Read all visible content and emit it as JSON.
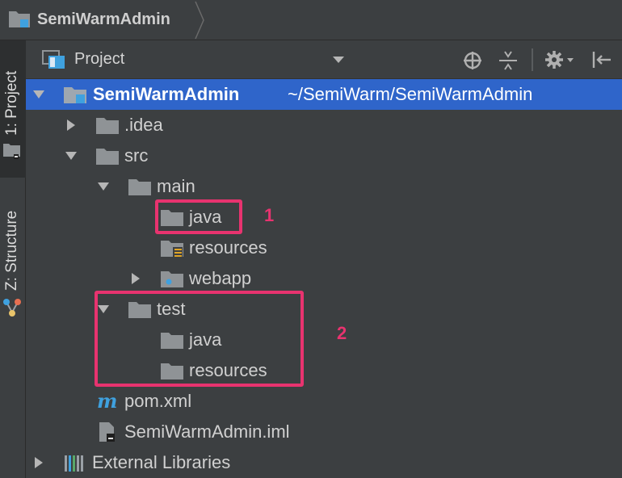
{
  "breadcrumb": {
    "project": "SemiWarmAdmin"
  },
  "side_tabs": {
    "project": "1: Project",
    "structure": "Z: Structure"
  },
  "panel": {
    "title": "Project"
  },
  "tree": {
    "root": {
      "name": "SemiWarmAdmin",
      "path": "~/SemiWarm/SemiWarmAdmin"
    },
    "idea": ".idea",
    "src": "src",
    "main": "main",
    "main_java": "java",
    "main_resources": "resources",
    "webapp": "webapp",
    "test": "test",
    "test_java": "java",
    "test_resources": "resources",
    "pom": "pom.xml",
    "iml": "SemiWarmAdmin.iml",
    "ext": "External Libraries"
  },
  "annotations": {
    "one": "1",
    "two": "2"
  },
  "colors": {
    "selection": "#2f65ca",
    "annotation": "#e8336f",
    "folder": "#8f9396",
    "module_blue": "#3fa1df"
  }
}
